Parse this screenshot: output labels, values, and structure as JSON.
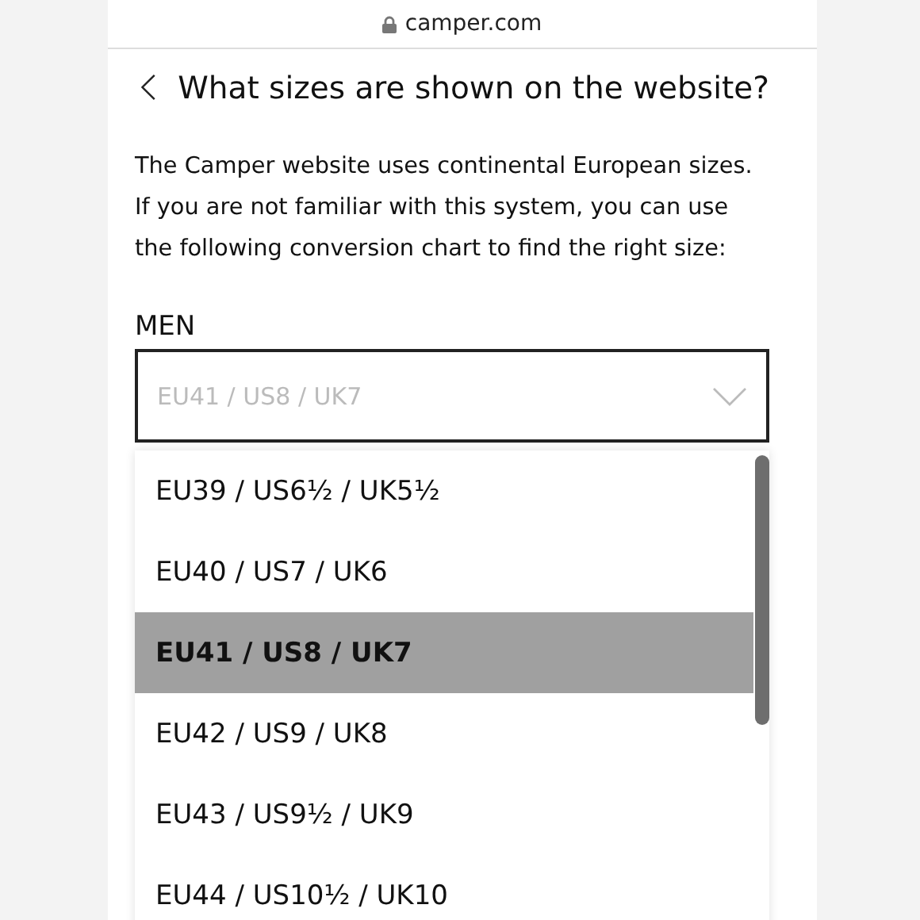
{
  "address_bar": {
    "url": "camper.com"
  },
  "header": {
    "title": "What sizes are shown on the website?"
  },
  "intro": "The Camper website uses continental European sizes. If you are not familiar with this system, you can use the following conversion chart to find the right size:",
  "size_select": {
    "label": "MEN",
    "value": "EU41 / US8 / UK7"
  },
  "options": [
    {
      "label": "EU39 / US6½ / UK5½",
      "selected": false
    },
    {
      "label": "EU40 / US7 / UK6",
      "selected": false
    },
    {
      "label": "EU41 / US8 / UK7",
      "selected": true
    },
    {
      "label": "EU42 / US9 / UK8",
      "selected": false
    },
    {
      "label": "EU43 / US9½ / UK9",
      "selected": false
    },
    {
      "label": "EU44 / US10½ / UK10",
      "selected": false
    }
  ]
}
